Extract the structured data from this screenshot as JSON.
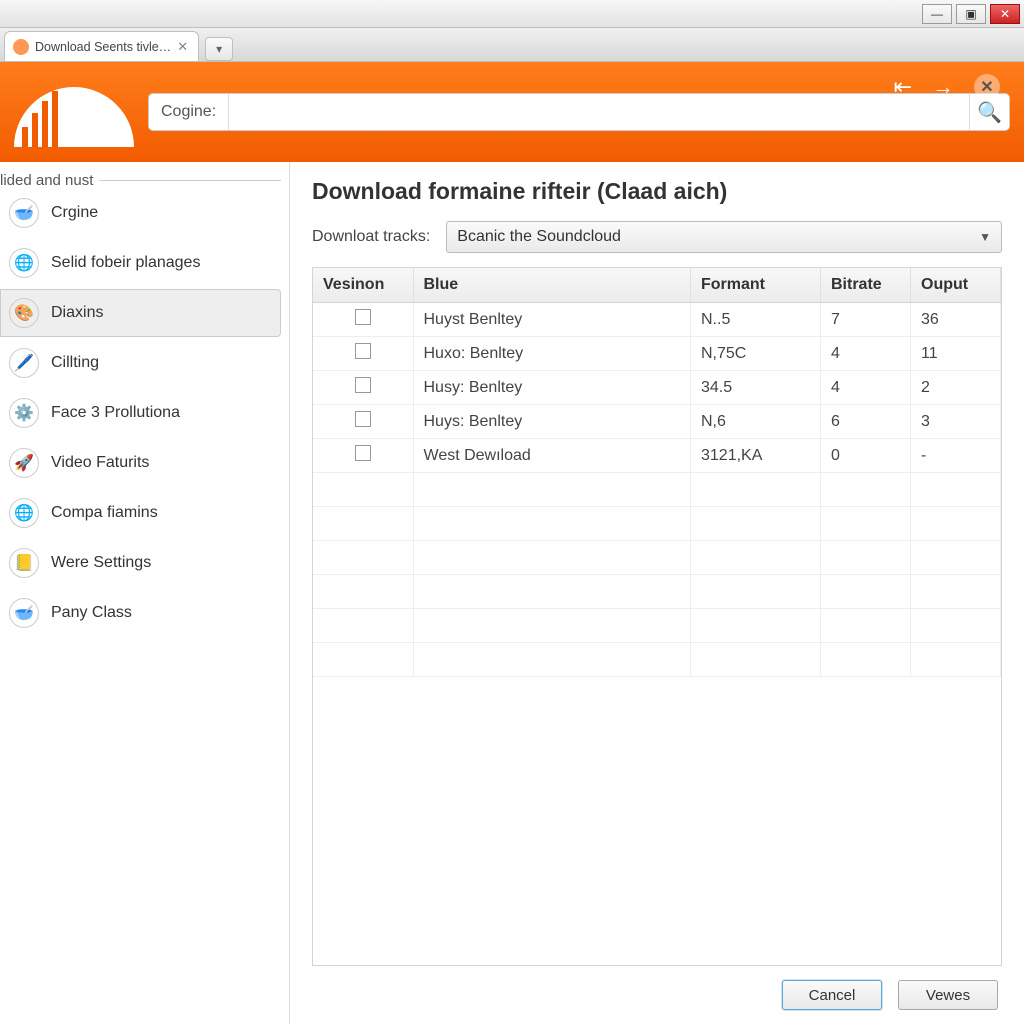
{
  "window": {
    "tab_title": "Download Seents tivle…"
  },
  "orangebar": {
    "search_prefix": "Cogine:",
    "search_value": ""
  },
  "sidebar": {
    "group_label": "lided and nust",
    "items": [
      {
        "label": "Crgine",
        "icon": "🥣",
        "selected": false
      },
      {
        "label": "Selid fobeir planages",
        "icon": "🌐",
        "selected": false
      },
      {
        "label": "Diaxins",
        "icon": "🎨",
        "selected": true
      },
      {
        "label": "Cillting",
        "icon": "🖊️",
        "selected": false
      },
      {
        "label": "Face 3 Prollutiona",
        "icon": "⚙️",
        "selected": false
      },
      {
        "label": "Video Faturits",
        "icon": "🚀",
        "selected": false
      },
      {
        "label": "Compa fiamins",
        "icon": "🌐",
        "selected": false
      },
      {
        "label": "Were Settings",
        "icon": "📒",
        "selected": false
      },
      {
        "label": "Pany Class",
        "icon": "🥣",
        "selected": false
      }
    ]
  },
  "main": {
    "title": "Download formaine rifteir (Claad aich)",
    "tracks_label": "Downloat tracks:",
    "tracks_selected": "Bcanic the Soundcloud",
    "columns": [
      "Vesinon",
      "Blue",
      "Formant",
      "Bitrate",
      "Ouput"
    ],
    "rows": [
      {
        "blue": "Huyst Benltey",
        "formant": "N..5",
        "bitrate": "7",
        "ouput": "36"
      },
      {
        "blue": "Huxo: Benltey",
        "formant": "N,75C",
        "bitrate": "4",
        "ouput": "11"
      },
      {
        "blue": "Husy: Benltey",
        "formant": "34.5",
        "bitrate": "4",
        "ouput": "2"
      },
      {
        "blue": "Huys: Benltey",
        "formant": "N,6",
        "bitrate": "6",
        "ouput": "3"
      },
      {
        "blue": "West Dewıload",
        "formant": "3121,KA",
        "bitrate": "0",
        "ouput": "-"
      }
    ],
    "cancel_label": "Cancel",
    "vewes_label": "Vewes"
  }
}
